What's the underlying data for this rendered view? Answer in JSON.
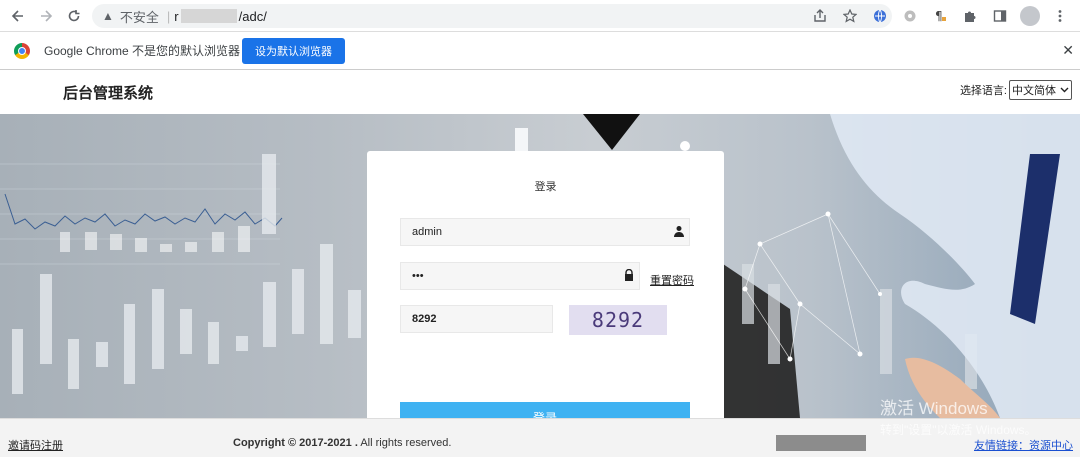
{
  "browser": {
    "insecure_label": "不安全",
    "separator": "|",
    "url_prefix": "r",
    "url_path": "/adc/",
    "toolbar_icons": [
      "share-icon",
      "star-icon",
      "extension-globe-icon",
      "extension-circle-icon",
      "extension-paragraph-icon",
      "puzzle-icon",
      "sidepanel-icon",
      "profile-avatar-icon",
      "more-menu-icon"
    ]
  },
  "infobar": {
    "message": "Google Chrome 不是您的默认浏览器",
    "button_label": "设为默认浏览器",
    "close_glyph": "✕"
  },
  "header": {
    "title": "后台管理系统",
    "language_label": "选择语言:",
    "language_selected": "中文简体"
  },
  "login": {
    "title": "登录",
    "username_value": "admin",
    "password_value": "•••",
    "reset_password_label": "重置密码",
    "captcha_value": "8292",
    "captcha_image_text": "8292",
    "submit_label": "登录"
  },
  "footer": {
    "register_link": "邀请码注册",
    "copyright_bold": "Copyright © 2017-2021 .",
    "copyright_rest": " All rights reserved.",
    "friend_links": "友情链接：资源中心"
  },
  "watermark": {
    "line1": "激活 Windows",
    "line2": "转到\"设置\"以激活 Windows。"
  },
  "colors": {
    "accent_button": "#1a73e8",
    "login_button": "#3fb2f2",
    "link": "#1a4fd0"
  }
}
